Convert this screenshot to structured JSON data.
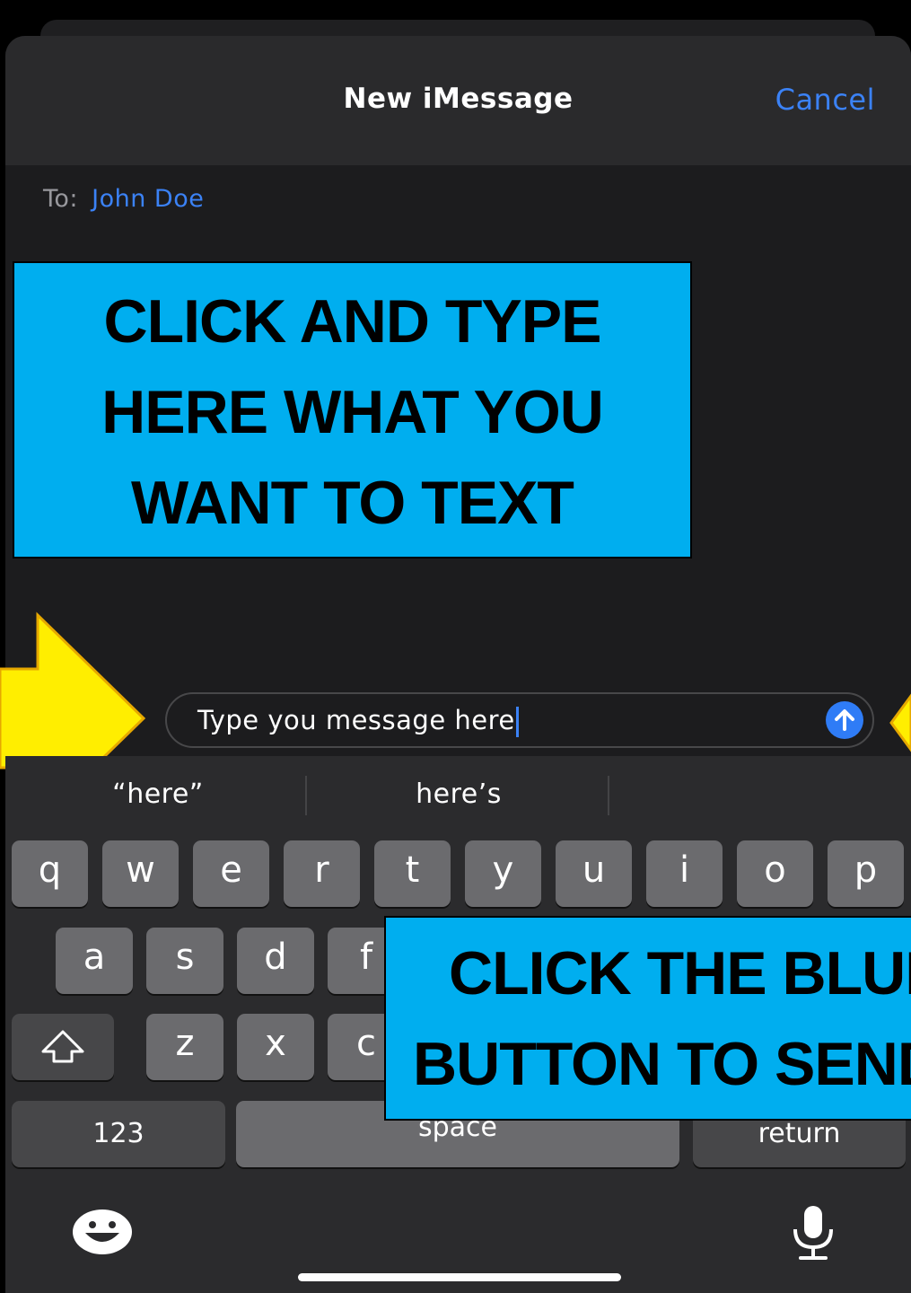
{
  "header": {
    "title": "New iMessage",
    "cancel_label": "Cancel"
  },
  "recipient": {
    "label": "To:",
    "name": "John Doe"
  },
  "callouts": {
    "type_instruction": [
      "CLICK AND TYPE",
      "HERE WHAT YOU",
      "WANT TO TEXT"
    ],
    "send_instruction": [
      "CLICK THE BLUE",
      "BUTTON TO SEND"
    ]
  },
  "message_input": {
    "value": "Type you message here",
    "send_icon": "arrow-up-icon",
    "send_color": "#2f7cf6"
  },
  "suggestions": [
    "“here”",
    "here’s",
    ""
  ],
  "keyboard": {
    "row1": [
      "q",
      "w",
      "e",
      "r",
      "t",
      "y",
      "u",
      "i",
      "o",
      "p"
    ],
    "row2": [
      "a",
      "s",
      "d",
      "f"
    ],
    "row3": [
      "z",
      "x",
      "c"
    ],
    "numbers_label": "123",
    "space_label": "space",
    "return_label": "return",
    "icons": [
      "shift-icon",
      "emoji-icon",
      "microphone-icon"
    ]
  },
  "colors": {
    "accent": "#3b82f6",
    "callout_bg": "#00aeef",
    "arrow_fill": "#ffee00"
  }
}
